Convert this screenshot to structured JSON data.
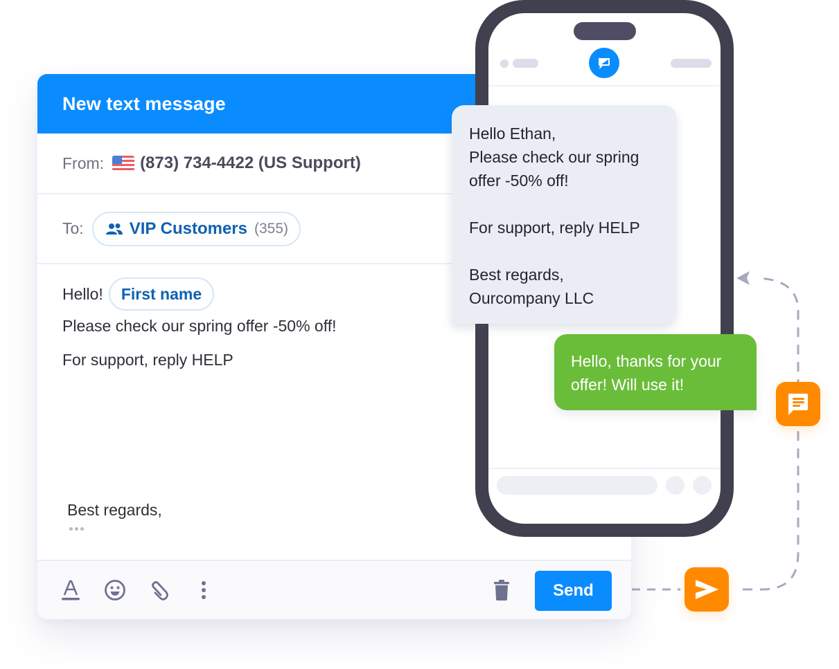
{
  "compose": {
    "title": "New text message",
    "from_label": "From:",
    "from_value": "(873) 734-4422 (US Support)",
    "from_flag": "us-flag-icon",
    "to_label": "To:",
    "to_recipient": {
      "icon": "people-icon",
      "label": "VIP Customers",
      "count": "(355)"
    },
    "body": {
      "greeting": "Hello!",
      "variable_chip": "First name",
      "line_2": "Please check our spring offer -50% off!",
      "line_3": "For support, reply HELP",
      "signature": "Best regards,"
    },
    "toolbar": {
      "icons": [
        "text-format-icon",
        "emoji-icon",
        "attachment-icon",
        "more-vertical-icon"
      ],
      "delete_icon": "trash-icon",
      "send_label": "Send"
    }
  },
  "phone": {
    "app_icon": "chat-icon",
    "incoming_message": "Hello Ethan,\nPlease check our spring\noffer -50% off!\n\nFor support, reply HELP\n\nBest regards,\nOurcompany LLC",
    "reply_message": "Hello, thanks for your\noffer! Will use it!"
  },
  "flow": {
    "reply_badge_icon": "message-lines-icon",
    "send_badge_icon": "send-arrow-icon"
  },
  "colors": {
    "primary": "#0a8cff",
    "accent_orange": "#ff8a00",
    "reply_green": "#6abd39",
    "phone_frame": "#41404f",
    "chip_text": "#0f62b2"
  }
}
